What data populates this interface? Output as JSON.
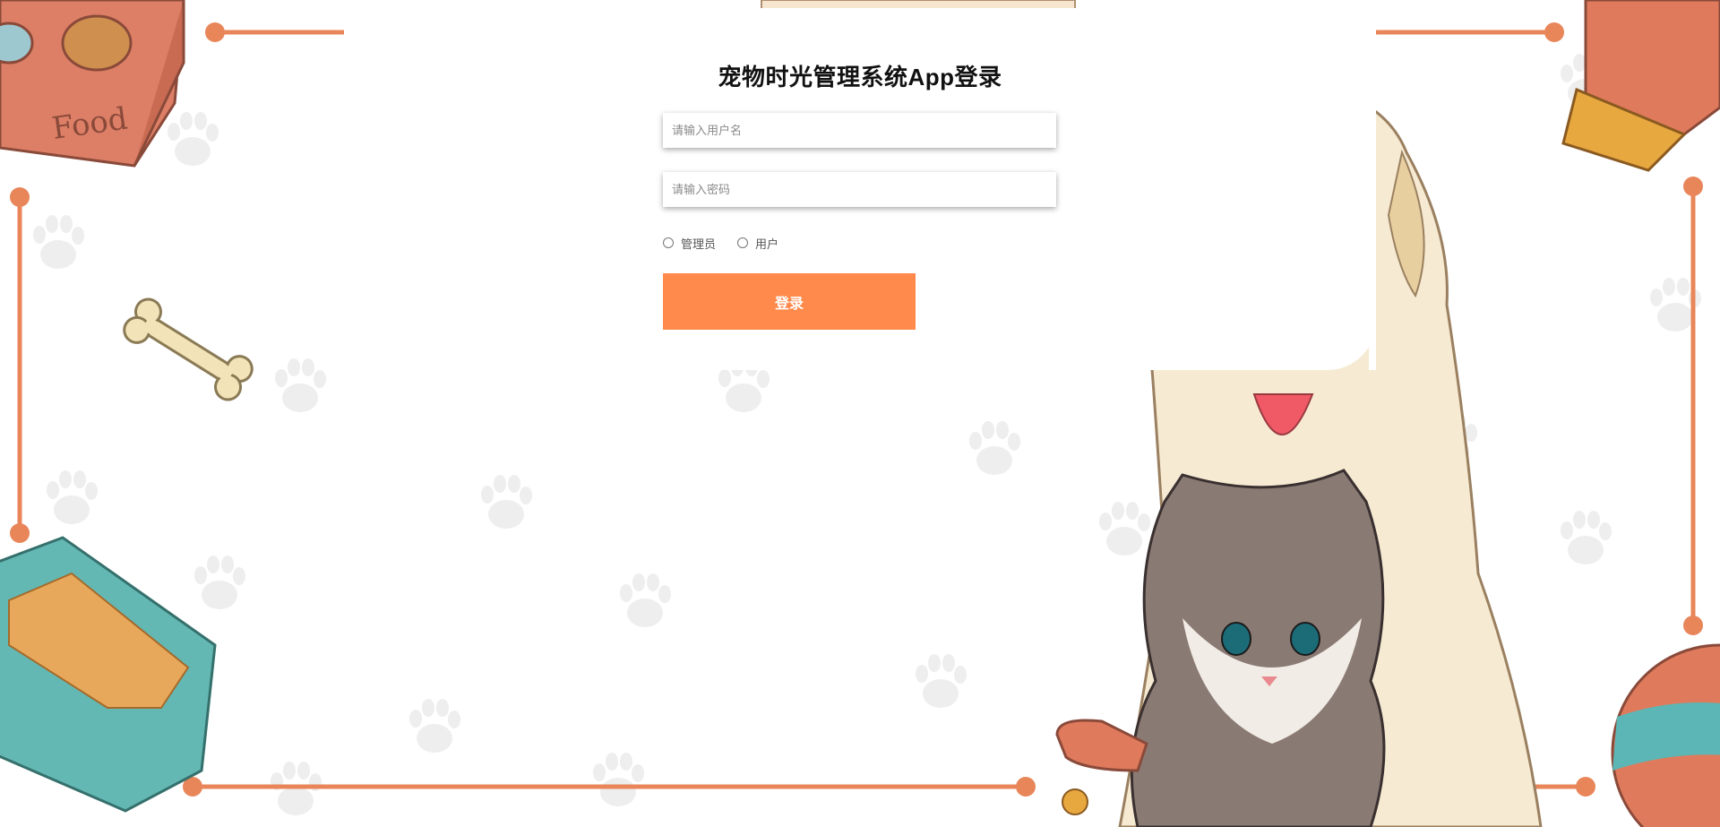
{
  "page": {
    "title": "宠物时光管理系统App登录"
  },
  "form": {
    "username_placeholder": "请输入用户名",
    "password_placeholder": "请输入密码",
    "roles": [
      {
        "label": "管理员",
        "value": "admin"
      },
      {
        "label": "用户",
        "value": "user"
      }
    ],
    "login_label": "登录"
  },
  "background": {
    "food_box_text": "Food"
  },
  "colors": {
    "accent": "#ff8a4c",
    "frame_orange": "#e8865a",
    "teal_tray": "#64b8b4",
    "cream": "#f3e3b8"
  },
  "icons": [
    "paw-print-icon",
    "bone-icon",
    "brush-icon",
    "ball-icon",
    "food-bowl-icon",
    "dog-illustration",
    "cat-illustration"
  ]
}
